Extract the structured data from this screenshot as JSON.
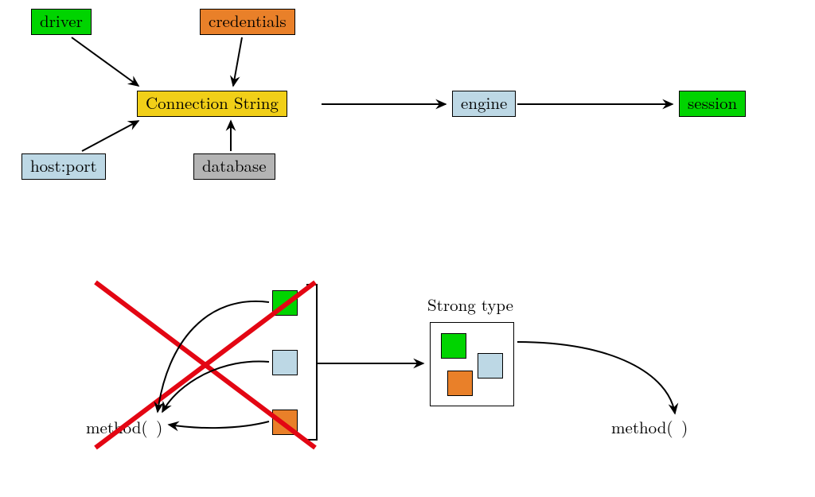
{
  "diagram1": {
    "driver": {
      "label": "driver",
      "color": "green"
    },
    "credentials": {
      "label": "credentials",
      "color": "orange"
    },
    "hostport": {
      "label": "host:port",
      "color": "blue"
    },
    "database": {
      "label": "database",
      "color": "gray"
    },
    "connstr": {
      "label": "Connection String",
      "color": "yellow"
    },
    "engine": {
      "label": "engine",
      "color": "blue"
    },
    "session": {
      "label": "session",
      "color": "green"
    }
  },
  "diagram2": {
    "strong_type_label": "Strong type",
    "method_left": "method( )",
    "method_right": "method( )",
    "square_colors": [
      "green",
      "blue",
      "orange"
    ]
  }
}
